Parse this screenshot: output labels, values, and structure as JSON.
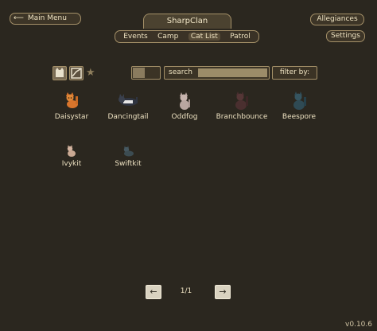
{
  "header": {
    "menu_button": "Main Menu",
    "clan_name": "SharpClan",
    "allegiances_button": "Allegiances",
    "settings_button": "Settings",
    "tabs": [
      "Events",
      "Camp",
      "Cat List",
      "Patrol"
    ],
    "active_tab": "Cat List"
  },
  "toolbar": {
    "search_label": "search",
    "search_value": "",
    "filter_label": "filter by:"
  },
  "cats": [
    {
      "name": "Daisystar",
      "color": "#d9752c"
    },
    {
      "name": "Dancingtail",
      "color": "#2f3440"
    },
    {
      "name": "Oddfog",
      "color": "#b9a6a0"
    },
    {
      "name": "Branchbounce",
      "color": "#4a2f2f"
    },
    {
      "name": "Beespore",
      "color": "#2f4a54"
    },
    {
      "name": "Ivykit",
      "color": "#c9a892"
    },
    {
      "name": "Swiftkit",
      "color": "#3c4c52"
    }
  ],
  "pagination": {
    "page": "1/1"
  },
  "version": "v0.10.6"
}
